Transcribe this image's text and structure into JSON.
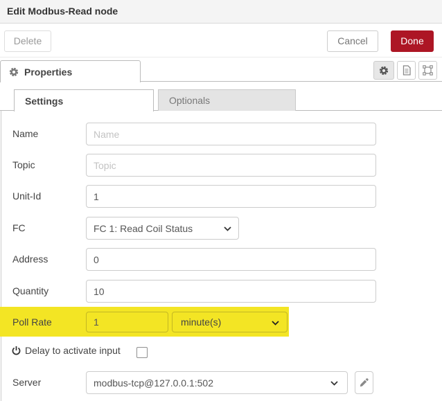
{
  "window": {
    "title": "Edit Modbus-Read node"
  },
  "header_buttons": {
    "delete": "Delete",
    "cancel": "Cancel",
    "done": "Done"
  },
  "editor_tabs": {
    "properties_label": "Properties"
  },
  "subtabs": {
    "settings": "Settings",
    "optionals": "Optionals"
  },
  "form": {
    "name": {
      "label": "Name",
      "placeholder": "Name",
      "value": ""
    },
    "topic": {
      "label": "Topic",
      "placeholder": "Topic",
      "value": ""
    },
    "unit_id": {
      "label": "Unit-Id",
      "value": "1"
    },
    "fc": {
      "label": "FC",
      "selected": "FC 1: Read Coil Status"
    },
    "address": {
      "label": "Address",
      "value": "0"
    },
    "quantity": {
      "label": "Quantity",
      "value": "10"
    },
    "poll_rate": {
      "label": "Poll Rate",
      "value": "1",
      "unit_selected": "minute(s)"
    },
    "delay": {
      "label": "Delay to activate input",
      "checked": false
    },
    "server": {
      "label": "Server",
      "selected": "modbus-tcp@127.0.0.1:502"
    }
  },
  "icons": {
    "properties_tab": "gear-icon",
    "toolbar": [
      "gear-icon",
      "doc-icon",
      "appearance-icon"
    ],
    "delay_row": "power-icon",
    "server_edit": "pencil-icon",
    "dropdowns": "chevron-down-icon"
  },
  "colors": {
    "done_button": "#AD1625",
    "highlight": "#F3E524",
    "header_bg": "#F4F4F4"
  }
}
